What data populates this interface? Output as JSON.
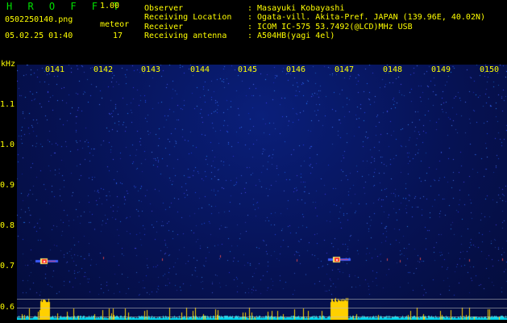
{
  "header": {
    "app_title": "H R O F F T",
    "app_version": "1.00",
    "filename": "0502250140.png",
    "datetime": "05.02.25 01:40",
    "meteor_label": "meteor",
    "meteor_count": "17"
  },
  "info": [
    {
      "label": "Observer",
      "value": ": Masayuki Kobayashi"
    },
    {
      "label": "Receiving Location",
      "value": ": Ogata-vill. Akita-Pref. JAPAN (139.96E, 40.02N)"
    },
    {
      "label": "Receiver",
      "value": ": ICOM IC-575 53.7492(@LCD)MHz USB"
    },
    {
      "label": "Receiving antenna",
      "value": ": A504HB(yagi 4el)"
    }
  ],
  "axis": {
    "unit": "kHz",
    "y_ticks": [
      "1.1",
      "1.0",
      "0.9",
      "0.8",
      "0.7",
      "0.6"
    ],
    "x_ticks": [
      "0141",
      "0142",
      "0143",
      "0144",
      "0145",
      "0146",
      "0147",
      "0148",
      "0149",
      "0150"
    ]
  },
  "colors": {
    "text": "#ffff00",
    "title": "#00e000",
    "background": "#000000",
    "noise": "#1e3cff",
    "meteor": "#ff3030",
    "level_bar": "#ffd000",
    "level_floor": "#00e5ff"
  }
}
